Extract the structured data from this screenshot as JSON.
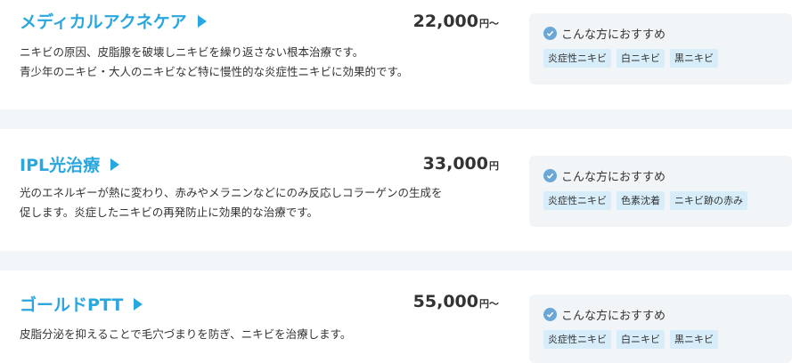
{
  "treatments": [
    {
      "name": "メディカルアクネケア",
      "price": "22,000",
      "unit": "円～",
      "desc": [
        "ニキビの原因、皮脂腺を破壊しニキビを繰り返さない根本治療です。",
        "青少年のニキビ・大人のニキビなど特に慢性的な炎症性ニキビに効果的です。"
      ],
      "rec_title": "こんな方におすすめ",
      "tags": [
        "炎症性ニキビ",
        "白ニキビ",
        "黒ニキビ"
      ]
    },
    {
      "name": "IPL光治療",
      "price": "33,000",
      "unit": "円",
      "desc": [
        "光のエネルギーが熱に変わり、赤みやメラニンなどにのみ反応しコラーゲンの生成を",
        "促します。炎症したニキビの再発防止に効果的な治療です。"
      ],
      "rec_title": "こんな方におすすめ",
      "tags": [
        "炎症性ニキビ",
        "色素沈着",
        "ニキビ跡の赤み"
      ]
    },
    {
      "name": "ゴールドPTT",
      "price": "55,000",
      "unit": "円～",
      "desc": [
        "皮脂分泌を抑えることで毛穴づまりを防ぎ、ニキビを治療します。"
      ],
      "rec_title": "こんな方におすすめ",
      "tags": [
        "炎症性ニキビ",
        "白ニキビ",
        "黒ニキビ"
      ]
    }
  ]
}
